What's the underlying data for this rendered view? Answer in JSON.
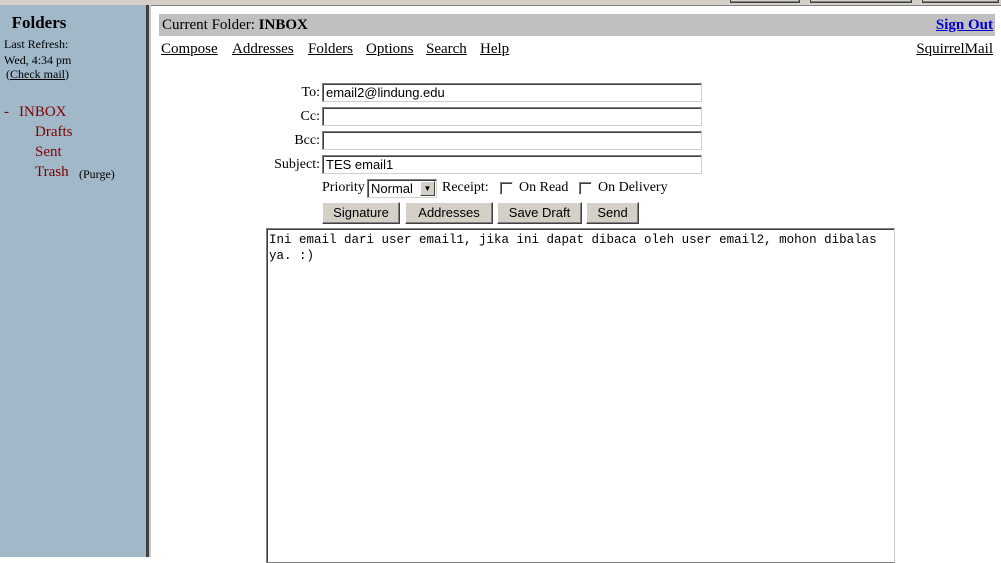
{
  "sidebar": {
    "title": "Folders",
    "last_refresh_label": "Last Refresh:",
    "last_refresh_time": "Wed, 4:34 pm",
    "check_mail": "Check mail",
    "folders": [
      {
        "label": "INBOX",
        "expanded_marker": "-"
      },
      {
        "label": "Drafts"
      },
      {
        "label": "Sent"
      },
      {
        "label": "Trash"
      }
    ],
    "purge": "(Purge)"
  },
  "header": {
    "current_folder_label": "Current Folder:",
    "current_folder": "INBOX",
    "sign_out": "Sign Out",
    "brand": "SquirrelMail"
  },
  "menu": [
    "Compose",
    "Addresses",
    "Folders",
    "Options",
    "Search",
    "Help"
  ],
  "compose": {
    "to_label": "To:",
    "to": "email2@lindung.edu",
    "cc_label": "Cc:",
    "cc": "",
    "bcc_label": "Bcc:",
    "bcc": "",
    "subject_label": "Subject:",
    "subject": "TES email1",
    "priority_label": "Priority",
    "priority": "Normal",
    "receipt_label": "Receipt:",
    "on_read": "On Read",
    "on_delivery": "On Delivery",
    "buttons": {
      "signature": "Signature",
      "addresses": "Addresses",
      "save_draft": "Save Draft",
      "send": "Send"
    },
    "body": "Ini email dari user email1, jika ini dapat dibaca oleh user email2, mohon dibalas ya. :)"
  },
  "colors": {
    "sidebar_bg": "#a0b8c8",
    "folder_link": "#800000",
    "header_bar": "#c0c0c0",
    "sign_out_link": "#0000cc"
  }
}
